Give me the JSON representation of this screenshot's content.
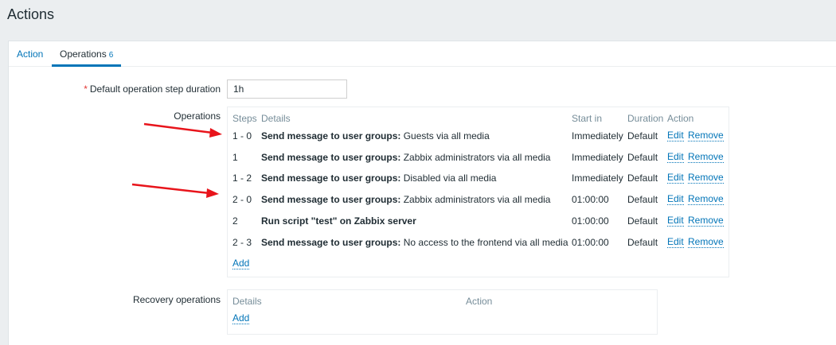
{
  "page": {
    "title": "Actions"
  },
  "tabs": [
    {
      "label": "Action"
    },
    {
      "label": "Operations",
      "count": "6"
    }
  ],
  "form": {
    "step_duration_label": "Default operation step duration",
    "step_duration_value": "1h",
    "operations_label": "Operations",
    "recovery_label": "Recovery operations"
  },
  "operations": {
    "headers": {
      "steps": "Steps",
      "details": "Details",
      "start_in": "Start in",
      "duration": "Duration",
      "action": "Action"
    },
    "rows": [
      {
        "steps": "1 - 0",
        "detail_bold": "Send message to user groups:",
        "detail_rest": " Guests via all media",
        "start_in": "Immediately",
        "duration": "Default",
        "edit": "Edit",
        "remove": "Remove"
      },
      {
        "steps": "1",
        "detail_bold": "Send message to user groups:",
        "detail_rest": " Zabbix administrators via all media",
        "start_in": "Immediately",
        "duration": "Default",
        "edit": "Edit",
        "remove": "Remove"
      },
      {
        "steps": "1 - 2",
        "detail_bold": "Send message to user groups:",
        "detail_rest": " Disabled via all media",
        "start_in": "Immediately",
        "duration": "Default",
        "edit": "Edit",
        "remove": "Remove"
      },
      {
        "steps": "2 - 0",
        "detail_bold": "Send message to user groups:",
        "detail_rest": " Zabbix administrators via all media",
        "start_in": "01:00:00",
        "duration": "Default",
        "edit": "Edit",
        "remove": "Remove"
      },
      {
        "steps": "2",
        "detail_bold": "Run script \"test\" on Zabbix server",
        "detail_rest": "",
        "start_in": "01:00:00",
        "duration": "Default",
        "edit": "Edit",
        "remove": "Remove"
      },
      {
        "steps": "2 - 3",
        "detail_bold": "Send message to user groups:",
        "detail_rest": " No access to the frontend via all media",
        "start_in": "01:00:00",
        "duration": "Default",
        "edit": "Edit",
        "remove": "Remove"
      }
    ],
    "add_label": "Add"
  },
  "recovery": {
    "headers": {
      "details": "Details",
      "action": "Action"
    },
    "add_label": "Add"
  },
  "colors": {
    "accent": "#0275b8",
    "arrow": "#e8141b",
    "required": "#e33734"
  }
}
